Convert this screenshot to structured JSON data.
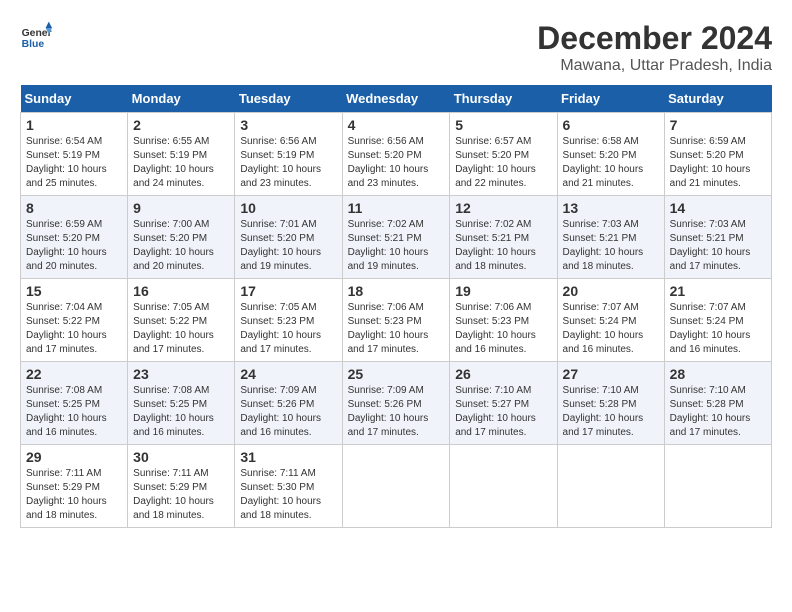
{
  "logo": {
    "line1": "General",
    "line2": "Blue"
  },
  "title": "December 2024",
  "location": "Mawana, Uttar Pradesh, India",
  "weekdays": [
    "Sunday",
    "Monday",
    "Tuesday",
    "Wednesday",
    "Thursday",
    "Friday",
    "Saturday"
  ],
  "weeks": [
    [
      {
        "day": 1,
        "sunrise": "6:54 AM",
        "sunset": "5:19 PM",
        "daylight": "10 hours and 25 minutes."
      },
      {
        "day": 2,
        "sunrise": "6:55 AM",
        "sunset": "5:19 PM",
        "daylight": "10 hours and 24 minutes."
      },
      {
        "day": 3,
        "sunrise": "6:56 AM",
        "sunset": "5:19 PM",
        "daylight": "10 hours and 23 minutes."
      },
      {
        "day": 4,
        "sunrise": "6:56 AM",
        "sunset": "5:20 PM",
        "daylight": "10 hours and 23 minutes."
      },
      {
        "day": 5,
        "sunrise": "6:57 AM",
        "sunset": "5:20 PM",
        "daylight": "10 hours and 22 minutes."
      },
      {
        "day": 6,
        "sunrise": "6:58 AM",
        "sunset": "5:20 PM",
        "daylight": "10 hours and 21 minutes."
      },
      {
        "day": 7,
        "sunrise": "6:59 AM",
        "sunset": "5:20 PM",
        "daylight": "10 hours and 21 minutes."
      }
    ],
    [
      {
        "day": 8,
        "sunrise": "6:59 AM",
        "sunset": "5:20 PM",
        "daylight": "10 hours and 20 minutes."
      },
      {
        "day": 9,
        "sunrise": "7:00 AM",
        "sunset": "5:20 PM",
        "daylight": "10 hours and 20 minutes."
      },
      {
        "day": 10,
        "sunrise": "7:01 AM",
        "sunset": "5:20 PM",
        "daylight": "10 hours and 19 minutes."
      },
      {
        "day": 11,
        "sunrise": "7:02 AM",
        "sunset": "5:21 PM",
        "daylight": "10 hours and 19 minutes."
      },
      {
        "day": 12,
        "sunrise": "7:02 AM",
        "sunset": "5:21 PM",
        "daylight": "10 hours and 18 minutes."
      },
      {
        "day": 13,
        "sunrise": "7:03 AM",
        "sunset": "5:21 PM",
        "daylight": "10 hours and 18 minutes."
      },
      {
        "day": 14,
        "sunrise": "7:03 AM",
        "sunset": "5:21 PM",
        "daylight": "10 hours and 17 minutes."
      }
    ],
    [
      {
        "day": 15,
        "sunrise": "7:04 AM",
        "sunset": "5:22 PM",
        "daylight": "10 hours and 17 minutes."
      },
      {
        "day": 16,
        "sunrise": "7:05 AM",
        "sunset": "5:22 PM",
        "daylight": "10 hours and 17 minutes."
      },
      {
        "day": 17,
        "sunrise": "7:05 AM",
        "sunset": "5:23 PM",
        "daylight": "10 hours and 17 minutes."
      },
      {
        "day": 18,
        "sunrise": "7:06 AM",
        "sunset": "5:23 PM",
        "daylight": "10 hours and 17 minutes."
      },
      {
        "day": 19,
        "sunrise": "7:06 AM",
        "sunset": "5:23 PM",
        "daylight": "10 hours and 16 minutes."
      },
      {
        "day": 20,
        "sunrise": "7:07 AM",
        "sunset": "5:24 PM",
        "daylight": "10 hours and 16 minutes."
      },
      {
        "day": 21,
        "sunrise": "7:07 AM",
        "sunset": "5:24 PM",
        "daylight": "10 hours and 16 minutes."
      }
    ],
    [
      {
        "day": 22,
        "sunrise": "7:08 AM",
        "sunset": "5:25 PM",
        "daylight": "10 hours and 16 minutes."
      },
      {
        "day": 23,
        "sunrise": "7:08 AM",
        "sunset": "5:25 PM",
        "daylight": "10 hours and 16 minutes."
      },
      {
        "day": 24,
        "sunrise": "7:09 AM",
        "sunset": "5:26 PM",
        "daylight": "10 hours and 16 minutes."
      },
      {
        "day": 25,
        "sunrise": "7:09 AM",
        "sunset": "5:26 PM",
        "daylight": "10 hours and 17 minutes."
      },
      {
        "day": 26,
        "sunrise": "7:10 AM",
        "sunset": "5:27 PM",
        "daylight": "10 hours and 17 minutes."
      },
      {
        "day": 27,
        "sunrise": "7:10 AM",
        "sunset": "5:28 PM",
        "daylight": "10 hours and 17 minutes."
      },
      {
        "day": 28,
        "sunrise": "7:10 AM",
        "sunset": "5:28 PM",
        "daylight": "10 hours and 17 minutes."
      }
    ],
    [
      {
        "day": 29,
        "sunrise": "7:11 AM",
        "sunset": "5:29 PM",
        "daylight": "10 hours and 18 minutes."
      },
      {
        "day": 30,
        "sunrise": "7:11 AM",
        "sunset": "5:29 PM",
        "daylight": "10 hours and 18 minutes."
      },
      {
        "day": 31,
        "sunrise": "7:11 AM",
        "sunset": "5:30 PM",
        "daylight": "10 hours and 18 minutes."
      },
      null,
      null,
      null,
      null
    ]
  ],
  "labels": {
    "sunrise": "Sunrise:",
    "sunset": "Sunset:",
    "daylight": "Daylight:"
  }
}
